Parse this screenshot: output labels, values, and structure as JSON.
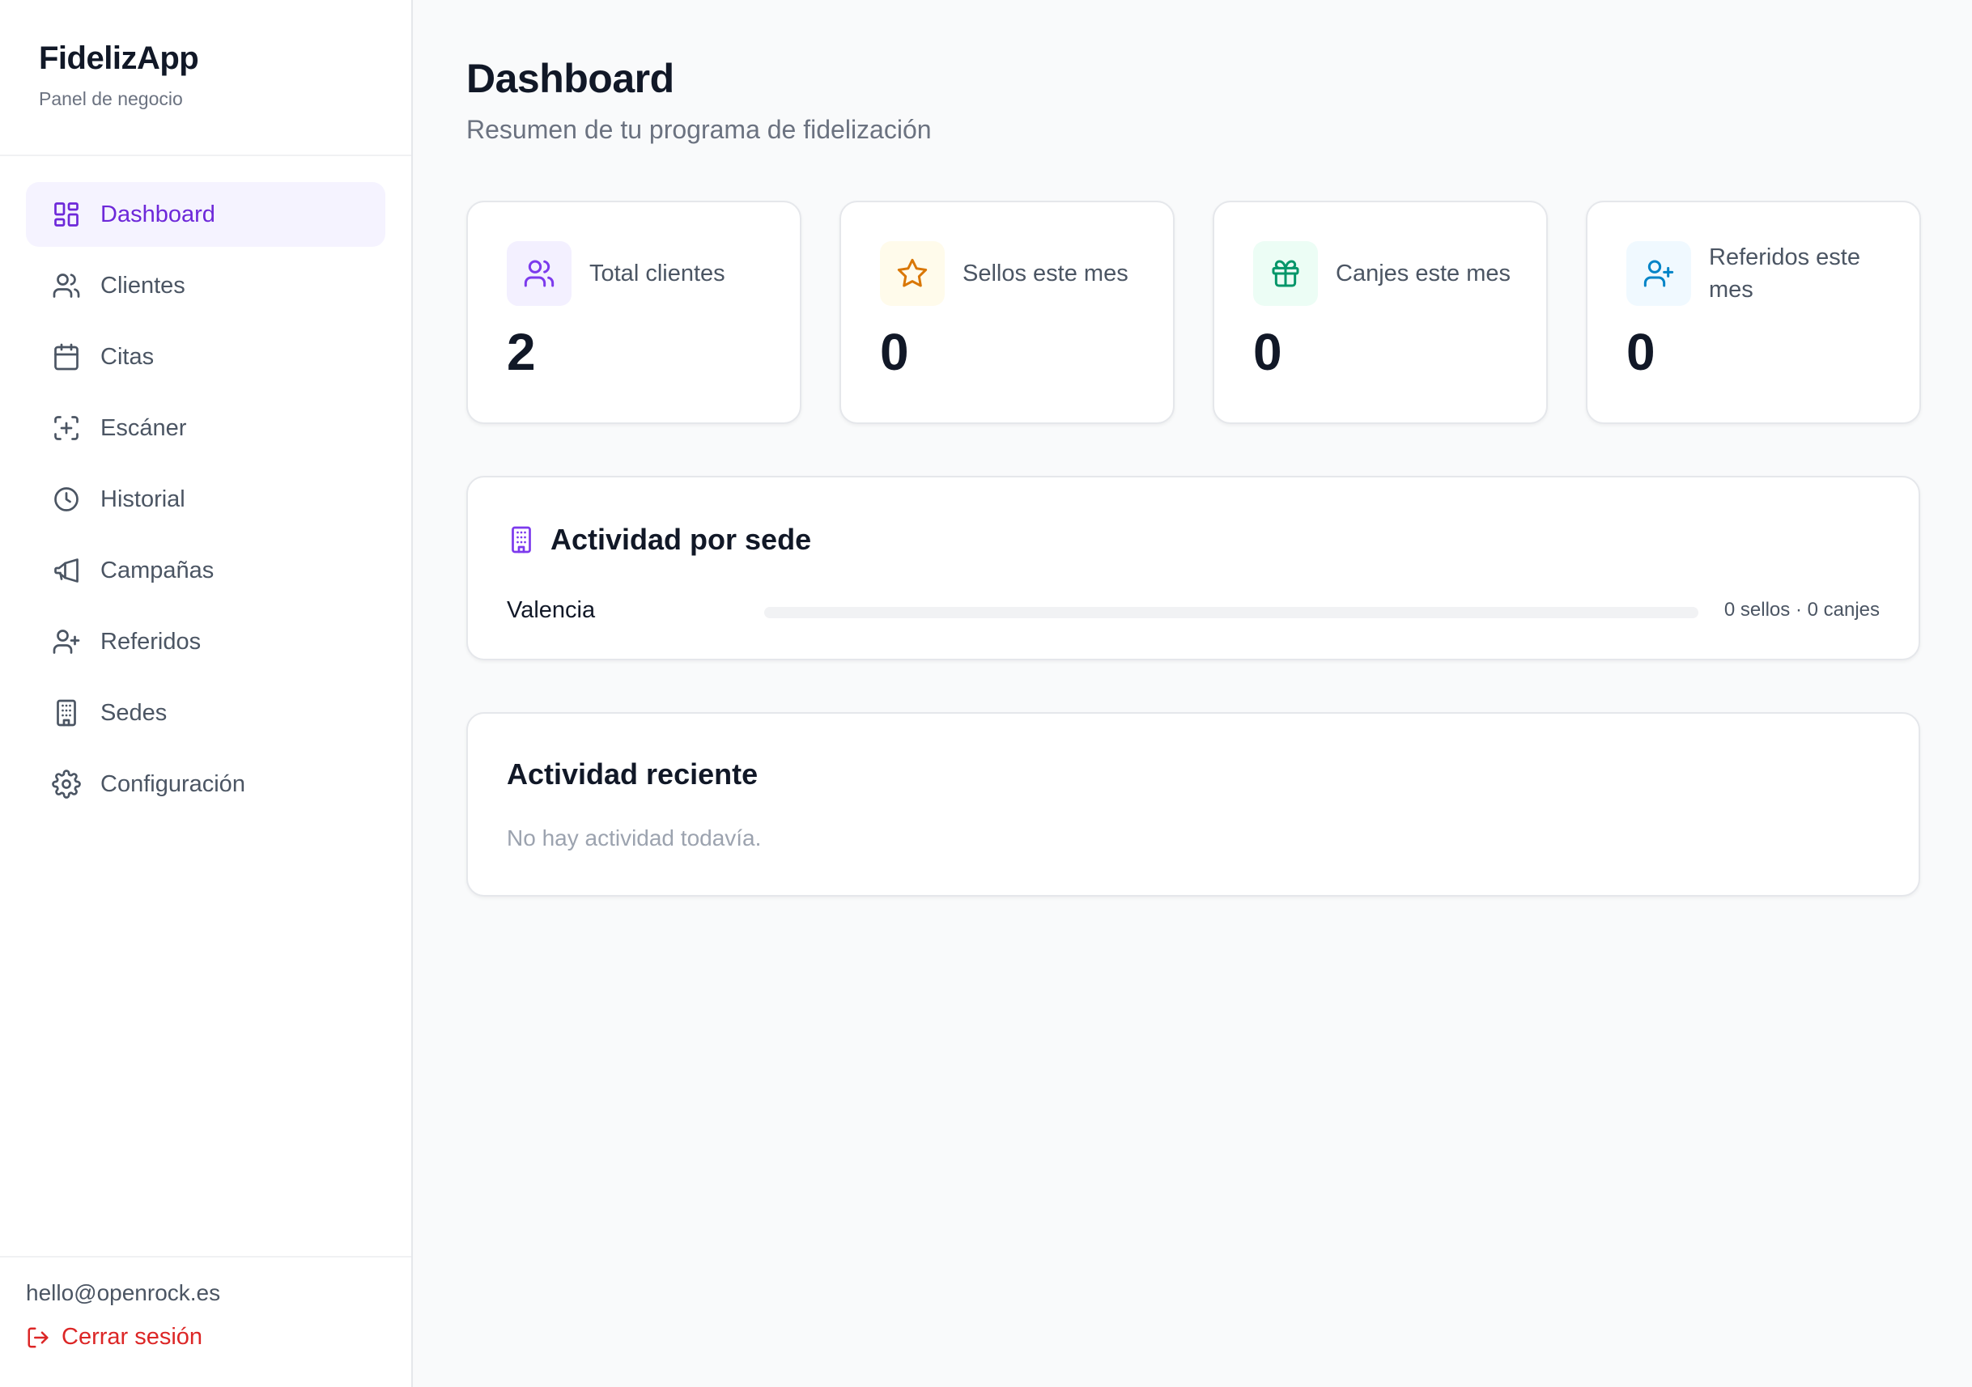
{
  "brand": {
    "name": "FidelizApp",
    "subtitle": "Panel de negocio"
  },
  "nav": [
    {
      "label": "Dashboard",
      "icon": "dashboard-icon",
      "active": true
    },
    {
      "label": "Clientes",
      "icon": "users-icon",
      "active": false
    },
    {
      "label": "Citas",
      "icon": "calendar-icon",
      "active": false
    },
    {
      "label": "Escáner",
      "icon": "scan-icon",
      "active": false
    },
    {
      "label": "Historial",
      "icon": "clock-icon",
      "active": false
    },
    {
      "label": "Campañas",
      "icon": "megaphone-icon",
      "active": false
    },
    {
      "label": "Referidos",
      "icon": "user-plus-icon",
      "active": false
    },
    {
      "label": "Sedes",
      "icon": "building-icon",
      "active": false
    },
    {
      "label": "Configuración",
      "icon": "gear-icon",
      "active": false
    }
  ],
  "user": {
    "email": "hello@openrock.es",
    "logout_label": "Cerrar sesión"
  },
  "page": {
    "title": "Dashboard",
    "subtitle": "Resumen de tu programa de fidelización"
  },
  "stats": [
    {
      "label": "Total clientes",
      "value": "2",
      "icon": "users-icon",
      "color": "#7c3aed",
      "bg": "#f3f0ff"
    },
    {
      "label": "Sellos este mes",
      "value": "0",
      "icon": "star-icon",
      "color": "#d97706",
      "bg": "#fffbeb"
    },
    {
      "label": "Canjes este mes",
      "value": "0",
      "icon": "gift-icon",
      "color": "#059669",
      "bg": "#ecfdf5"
    },
    {
      "label": "Referidos este mes",
      "value": "0",
      "icon": "user-plus-icon",
      "color": "#0284c7",
      "bg": "#f0f9ff"
    }
  ],
  "sedes_panel": {
    "title": "Actividad por sede",
    "rows": [
      {
        "name": "Valencia",
        "stats": "0 sellos · 0 canjes",
        "fill": 0
      }
    ]
  },
  "recent_panel": {
    "title": "Actividad reciente",
    "empty": "No hay actividad todavía."
  },
  "colors": {
    "accent": "#6d28d9",
    "active_bg": "#f5f3ff",
    "danger": "#dc2626"
  }
}
